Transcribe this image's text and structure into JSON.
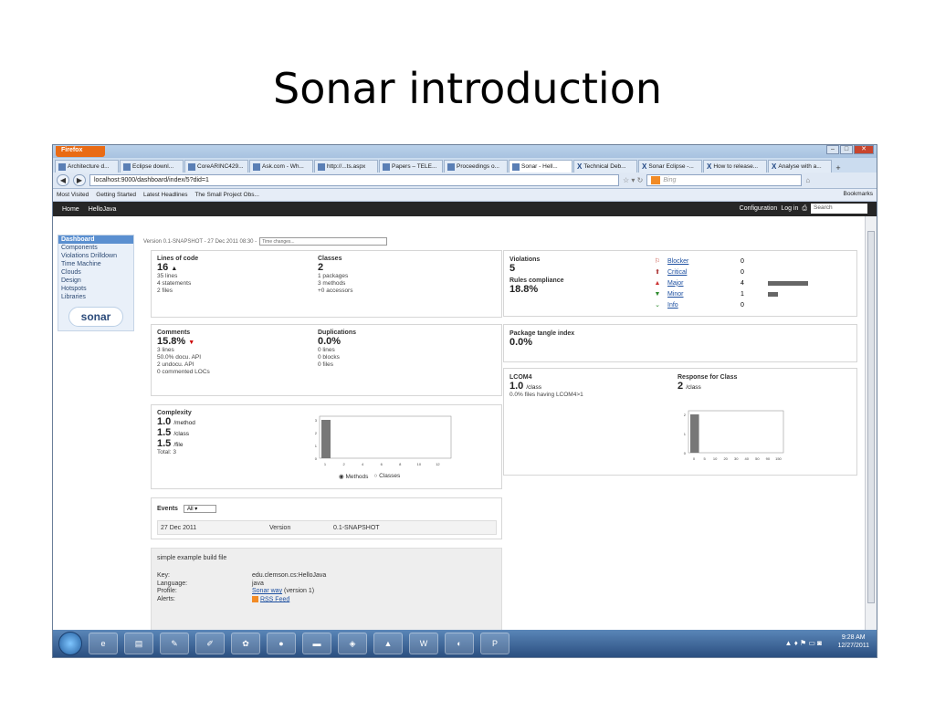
{
  "slide": {
    "title": "Sonar introduction"
  },
  "browser": {
    "firefox_label": "Firefox",
    "tabs": [
      {
        "label": "Architecture d..."
      },
      {
        "label": "Eclipse downl..."
      },
      {
        "label": "CoreARINC429..."
      },
      {
        "label": "Ask.com - Wh..."
      },
      {
        "label": "http://...ts.aspx"
      },
      {
        "label": "Papers – TELE..."
      },
      {
        "label": "Proceedings o..."
      },
      {
        "label": "Sonar - Hell...",
        "active": true
      },
      {
        "label": "Technical Deb..."
      },
      {
        "label": "Sonar Eclipse -..."
      },
      {
        "label": "How to release..."
      },
      {
        "label": "Analyse with a..."
      }
    ],
    "url": "localhost:9000/dashboard/index/5?did=1",
    "search_placeholder": "Bing",
    "bookmarks": [
      "Most Visited",
      "Getting Started",
      "Latest Headlines",
      "The Small Project Obs..."
    ],
    "bookmarks_right": "Bookmarks"
  },
  "sonar_nav": {
    "home": "Home",
    "project": "HelloJava",
    "configuration": "Configuration",
    "login": "Log in",
    "search_placeholder": "Search"
  },
  "sidebar": {
    "items": [
      "Dashboard",
      "Components",
      "Violations Drilldown",
      "Time Machine",
      "Clouds",
      "Design",
      "Hotspots",
      "Libraries"
    ],
    "logo": "sonar"
  },
  "version_bar": {
    "text": "Version 0.1-SNAPSHOT - 27 Dec 2011 08:30 -",
    "select": "Time changes..."
  },
  "loc": {
    "title": "Lines of code",
    "value": "16",
    "lines": "35 lines",
    "statements": "4 statements",
    "files": "2 files"
  },
  "classes": {
    "title": "Classes",
    "value": "2",
    "packages": "1 packages",
    "methods": "3 methods",
    "accessors": "+0 accessors"
  },
  "comments": {
    "title": "Comments",
    "value": "15.8%",
    "lines": "3 lines",
    "docu": "50.0% docu. API",
    "undocu": "2 undocu. API",
    "commented": "0 commented LOCs"
  },
  "duplications": {
    "title": "Duplications",
    "value": "0.0%",
    "lines": "0 lines",
    "blocks": "0 blocks",
    "files": "0 files"
  },
  "complexity": {
    "title": "Complexity",
    "method_value": "1.0",
    "method_unit": "/method",
    "class_value": "1.5",
    "class_unit": "/class",
    "file_value": "1.5",
    "file_unit": "/file",
    "total": "Total: 3",
    "radio_methods": "Methods",
    "radio_classes": "Classes"
  },
  "events": {
    "title": "Events",
    "filter": "All",
    "row": {
      "date": "27 Dec 2011",
      "category": "Version",
      "name": "0.1-SNAPSHOT"
    }
  },
  "description": {
    "title": "simple example build file",
    "key_label": "Key:",
    "key_value": "edu.clemson.cs:HelloJava",
    "lang_label": "Language:",
    "lang_value": "java",
    "profile_label": "Profile:",
    "profile_link": "Sonar way",
    "profile_suffix": "(version 1)",
    "alerts_label": "Alerts:",
    "alerts_link": "RSS Feed"
  },
  "violations": {
    "title": "Violations",
    "value": "5",
    "rules_title": "Rules compliance",
    "rules_value": "18.8%",
    "severities": [
      {
        "name": "Blocker",
        "count": "0",
        "color": "#c0392b"
      },
      {
        "name": "Critical",
        "count": "0",
        "color": "#a33"
      },
      {
        "name": "Major",
        "count": "4",
        "color": "#c33"
      },
      {
        "name": "Minor",
        "count": "1",
        "color": "#2e8b2e"
      },
      {
        "name": "Info",
        "count": "0",
        "color": "#2e8b2e"
      }
    ]
  },
  "tangle": {
    "title": "Package tangle index",
    "value": "0.0%"
  },
  "lcom4": {
    "title": "LCOM4",
    "value": "1.0",
    "unit": "/class",
    "note": "0.0% files having LCOM4>1"
  },
  "rfc": {
    "title": "Response for Class",
    "value": "2",
    "unit": "/class"
  },
  "taskbar": {
    "time": "9:28 AM",
    "date": "12/27/2011"
  },
  "chart_data": [
    {
      "type": "bar",
      "x": [
        1,
        2,
        4,
        6,
        8,
        10,
        12
      ],
      "values": [
        3,
        0,
        0,
        0,
        0,
        0,
        0
      ],
      "ylim": [
        0,
        3
      ]
    },
    {
      "type": "bar",
      "x": [
        0,
        5,
        10,
        20,
        30,
        40,
        50,
        90,
        150
      ],
      "values": [
        2,
        0,
        0,
        0,
        0,
        0,
        0,
        0,
        0
      ],
      "ylim": [
        0,
        2
      ]
    }
  ]
}
